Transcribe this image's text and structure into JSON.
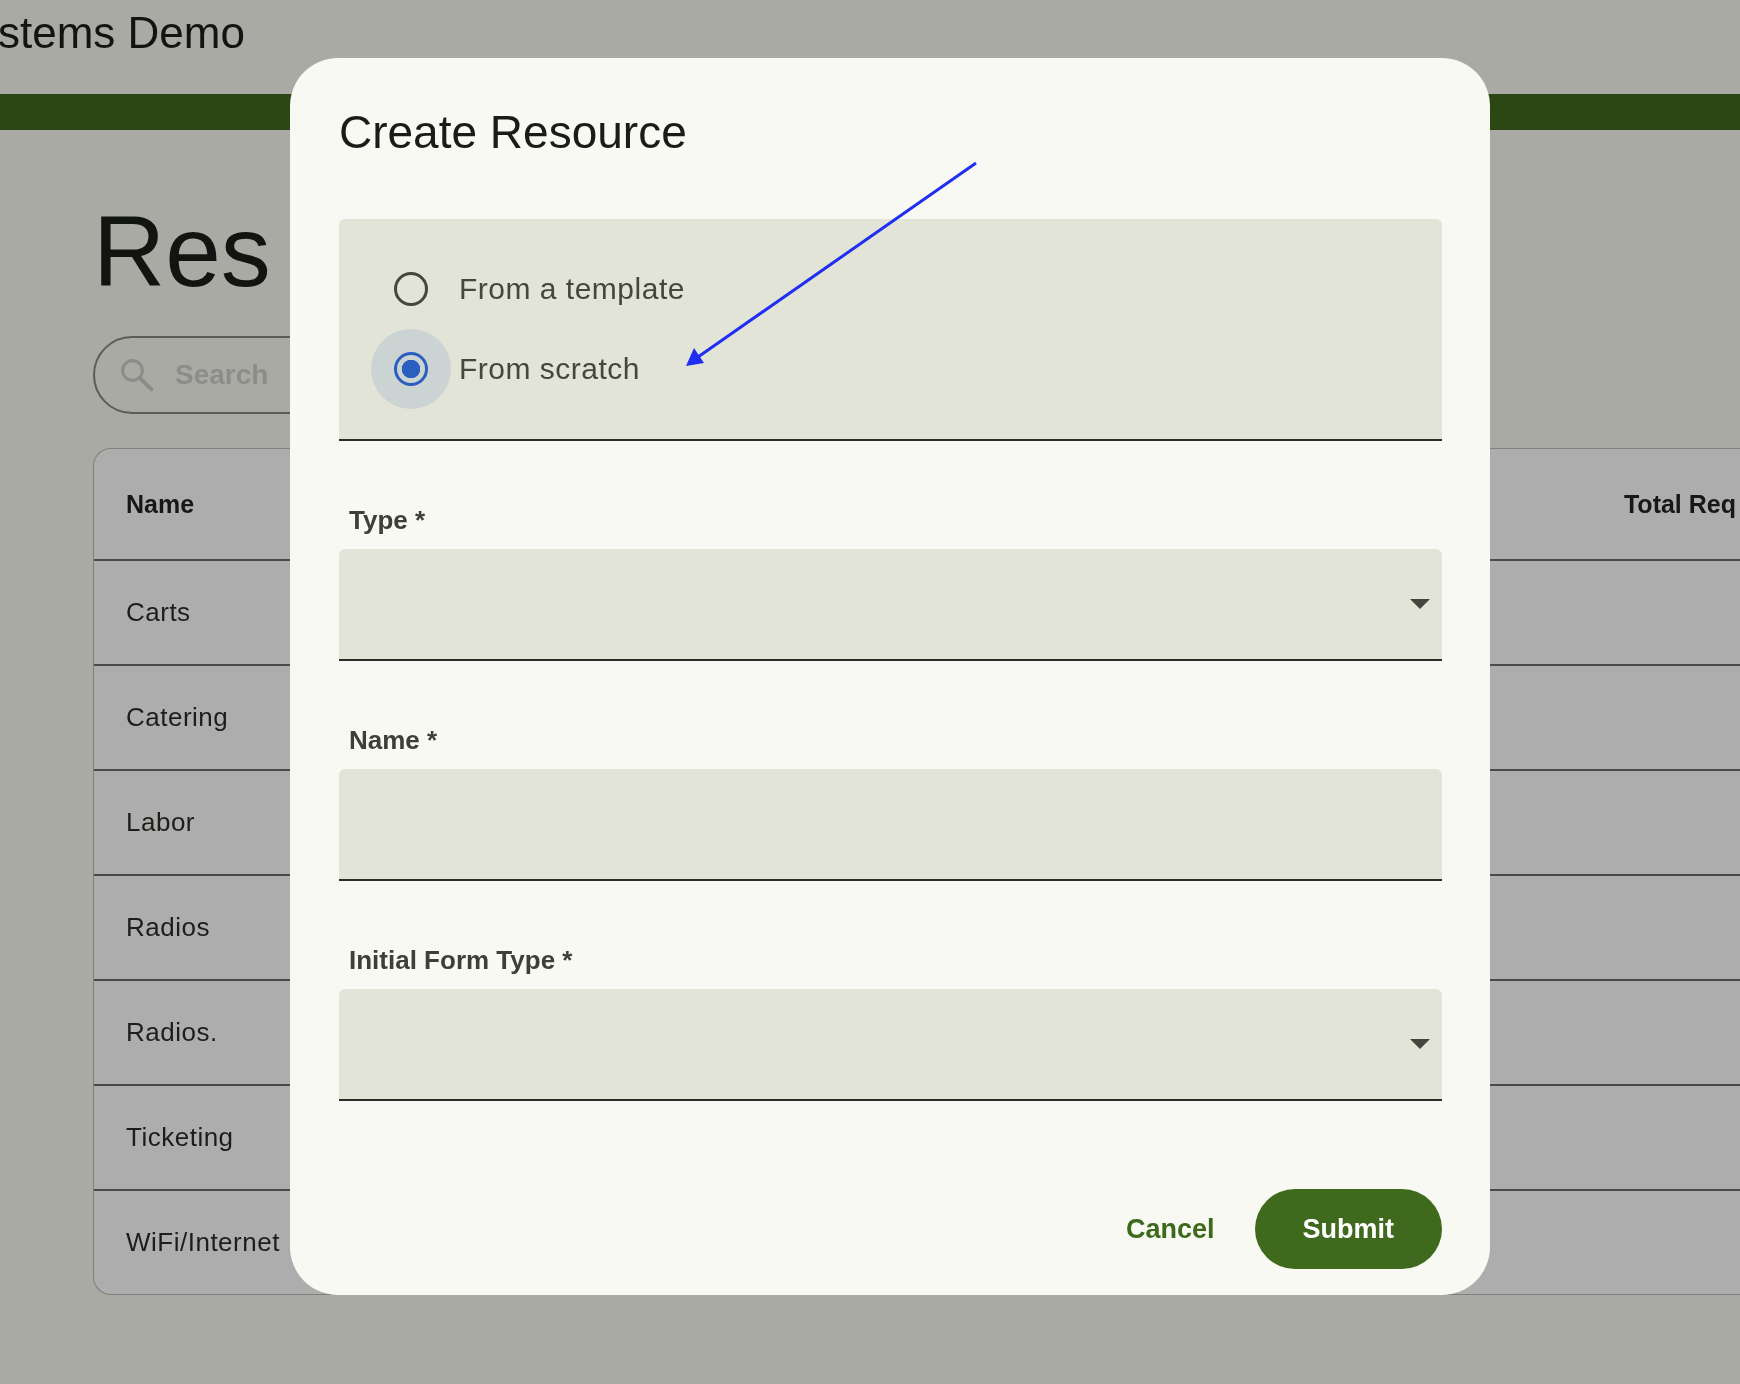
{
  "app_title": "stems Demo",
  "page": {
    "heading": "Res",
    "search": {
      "placeholder": "Search"
    },
    "table": {
      "columns": [
        "Name",
        "Total Req"
      ],
      "rows": [
        {
          "name": "Carts"
        },
        {
          "name": "Catering"
        },
        {
          "name": "Labor"
        },
        {
          "name": "Radios"
        },
        {
          "name": "Radios."
        },
        {
          "name": "Ticketing"
        },
        {
          "name": "WiFi/Internet"
        }
      ]
    }
  },
  "dialog": {
    "title": "Create Resource",
    "source_options": [
      {
        "label": "From a template",
        "selected": false
      },
      {
        "label": "From scratch",
        "selected": true
      }
    ],
    "fields": [
      {
        "kind": "select",
        "label": "Type *"
      },
      {
        "kind": "text",
        "label": "Name *"
      },
      {
        "kind": "select",
        "label": "Initial Form Type *"
      }
    ],
    "buttons": [
      {
        "kind": "text",
        "label": "Cancel"
      },
      {
        "kind": "filled",
        "label": "Submit"
      }
    ]
  }
}
